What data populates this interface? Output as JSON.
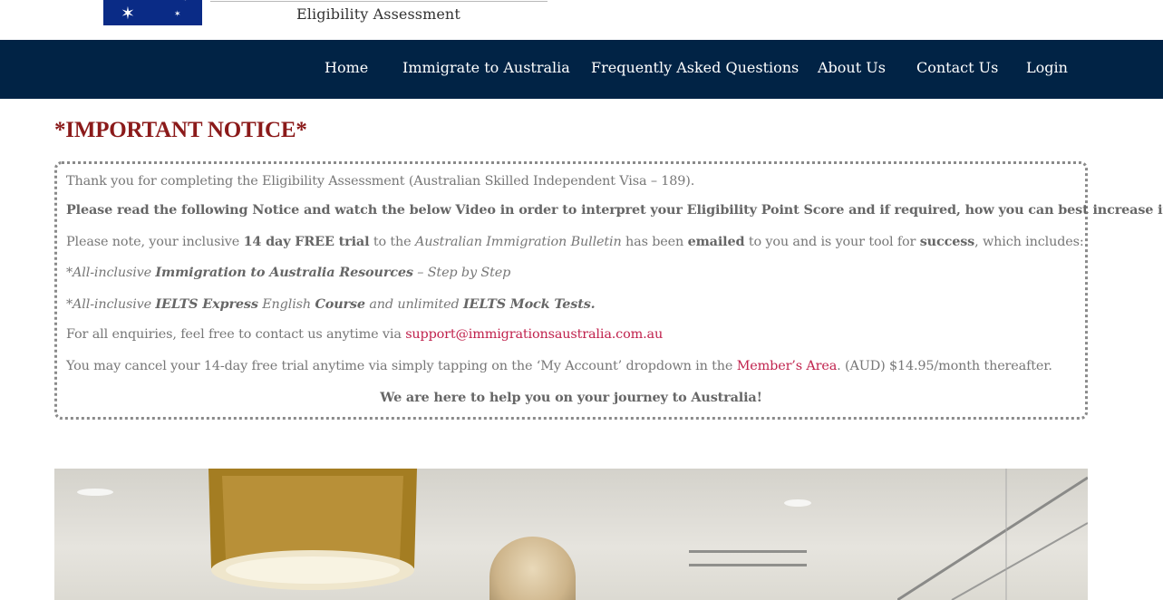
{
  "header": {
    "logo_subtitle": "Eligibility Assessment"
  },
  "nav": {
    "items": [
      "Home",
      "Immigrate to Australia",
      "Frequently Asked Questions",
      "About Us",
      "Contact Us",
      "Login"
    ]
  },
  "notice": {
    "title": "*IMPORTANT NOTICE*",
    "line1": "Thank you for completing the Eligibility Assessment (Australian Skilled Independent Visa – 189).",
    "line2": "Please read the following Notice and watch the below Video in order to interpret your Eligibility Point Score and if required, how you can best increase it!",
    "line3": {
      "a": "Please note, your inclusive ",
      "b": "14 day FREE trial",
      "c": " to the ",
      "d": "Australian Immigration Bulletin",
      "e": " has been ",
      "f": "emailed",
      "g": " to you and is your tool for ",
      "h": "success",
      "i": ", which includes:"
    },
    "line4": {
      "a": "*All-inclusive ",
      "b": "Immigration to Australia Resources",
      "c": " – Step by Step"
    },
    "line5": {
      "a": "*All-inclusive ",
      "b": "IELTS Express",
      "c": " English ",
      "d": "Course",
      "e": " and unlimited ",
      "f": "IELTS Mock Tests."
    },
    "line6": {
      "a": "For all enquiries, feel free to contact us anytime via ",
      "email": "support@immigrationsaustralia.com.au"
    },
    "line7": {
      "a": "You may cancel your 14-day free trial anytime via simply tapping on the ‘My Account’ dropdown in the ",
      "link": "Member’s Area",
      "b": ". (AUD) $14.95/month thereafter."
    },
    "closing": "We are here to help you on your journey to Australia!"
  },
  "colors": {
    "nav_bg": "#012345",
    "title": "#8b1a1a",
    "link": "#c0224d",
    "flag_blue": "#0a2b86"
  },
  "icons": [
    "australian-flag-logo"
  ]
}
